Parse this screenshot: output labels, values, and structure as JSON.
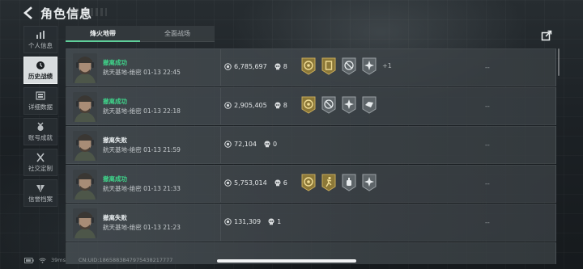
{
  "header": {
    "title": "角色信息"
  },
  "sidebar": {
    "items": [
      {
        "label": "个人信息",
        "icon": "bar-chart-icon"
      },
      {
        "label": "历史战绩",
        "icon": "clock-icon",
        "active": true
      },
      {
        "label": "详细数据",
        "icon": "data-sheet-icon"
      },
      {
        "label": "账号成就",
        "icon": "medal-icon"
      },
      {
        "label": "社交定制",
        "icon": "crossed-tools-icon"
      },
      {
        "label": "信誉档案",
        "icon": "shield-icon"
      }
    ]
  },
  "tabs": [
    {
      "label": "烽火地带",
      "active": true
    },
    {
      "label": "全面战场",
      "active": false
    }
  ],
  "records": [
    {
      "status": "撤离成功",
      "result": "success",
      "detail": "航天基地-绝密 01-13 22:45",
      "value": "6,785,697",
      "kills": "8",
      "badges": [
        "coin-medal-badge",
        "card-badge",
        "no-target-badge",
        "star-burst-badge"
      ],
      "more": "+1",
      "extra": "--"
    },
    {
      "status": "撤离成功",
      "result": "success",
      "detail": "航天基地-绝密 01-13 22:18",
      "value": "2,905,405",
      "kills": "8",
      "badges": [
        "coin-medal-badge",
        "no-target-badge",
        "star-burst-badge",
        "heal-badge"
      ],
      "more": "",
      "extra": "--"
    },
    {
      "status": "撤离失败",
      "result": "fail",
      "detail": "航天基地-绝密 01-13 21:59",
      "value": "72,104",
      "kills": "0",
      "badges": [],
      "more": "",
      "extra": "--"
    },
    {
      "status": "撤离成功",
      "result": "success",
      "detail": "航天基地-绝密 01-13 21:33",
      "value": "5,753,014",
      "kills": "6",
      "badges": [
        "coin-medal-badge",
        "runner-badge",
        "grenade-badge",
        "star-burst-badge"
      ],
      "more": "",
      "extra": "--"
    },
    {
      "status": "撤离失败",
      "result": "fail",
      "detail": "航天基地-绝密 01-13 21:23",
      "value": "131,309",
      "kills": "1",
      "badges": [],
      "more": "",
      "extra": "--"
    }
  ],
  "statusbar": {
    "ping": "39ms",
    "uid": "CN:UID:1865883847975438217777"
  },
  "colors": {
    "success": "#3fd48a",
    "tab_accent": "#5fcf9a",
    "badge_gold": "#b89b4e",
    "badge_gray": "#8b9296"
  }
}
